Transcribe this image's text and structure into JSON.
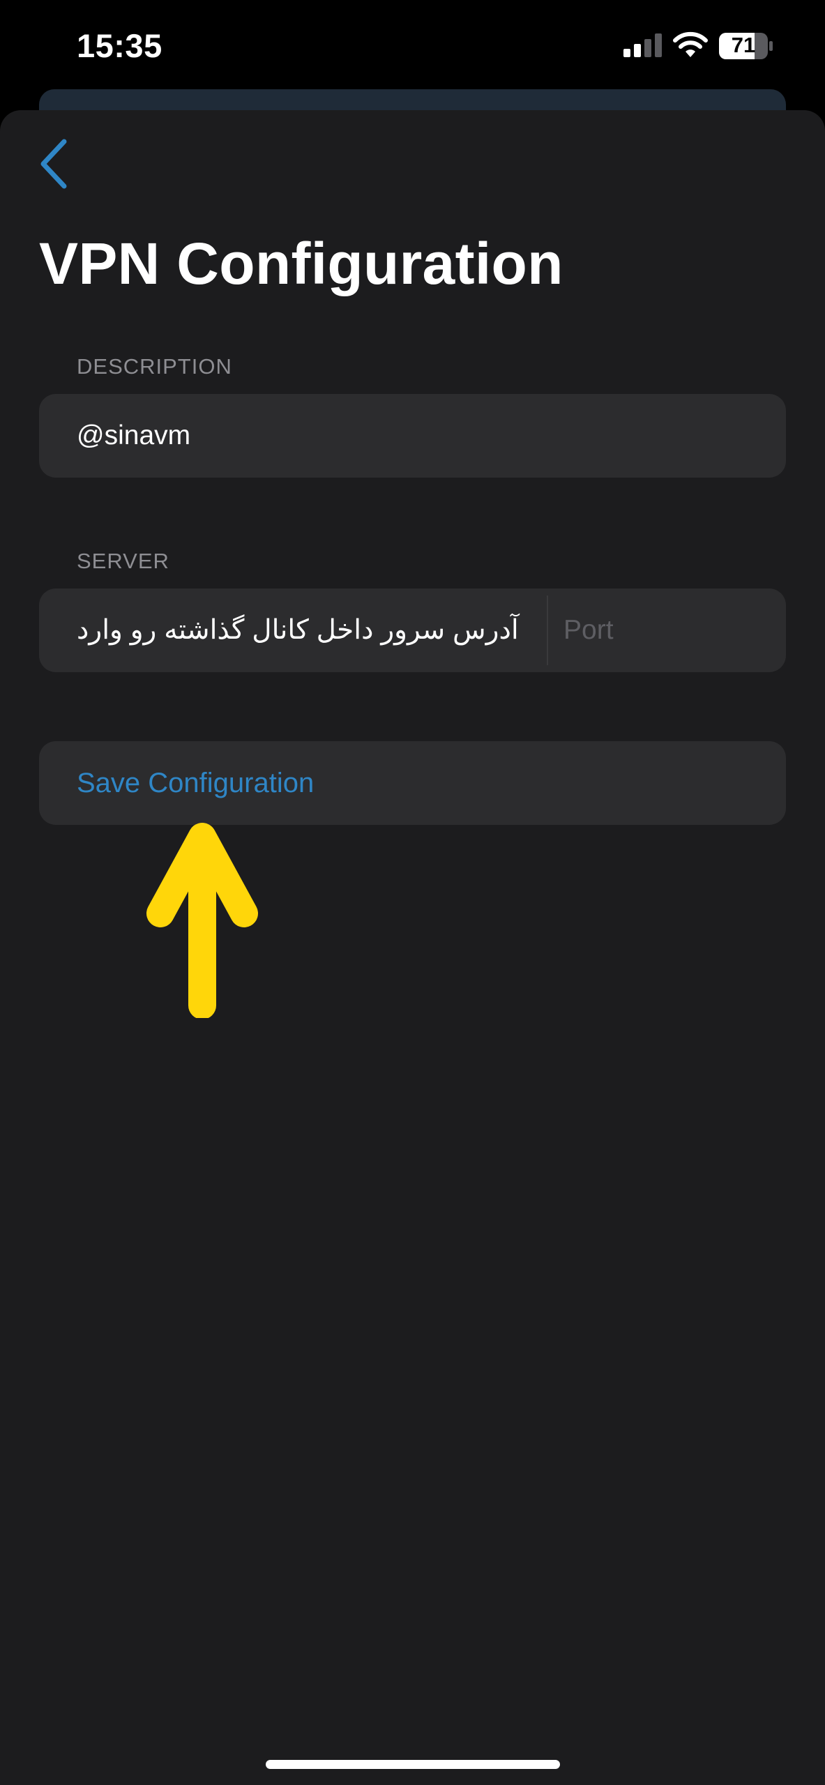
{
  "status_bar": {
    "time": "15:35",
    "battery": "71",
    "icons": [
      "signal-icon",
      "wifi-icon",
      "battery-icon"
    ]
  },
  "nav": {
    "back_icon": "chevron-left-icon"
  },
  "page": {
    "title": "VPN Configuration"
  },
  "description_section": {
    "label": "DESCRIPTION",
    "value": "@sinavm"
  },
  "server_section": {
    "label": "SERVER",
    "address_value": "آدرس سرور داخل کانال گذاشته رو وارد",
    "port_placeholder": "Port"
  },
  "actions": {
    "save_label": "Save Configuration"
  },
  "annotation": {
    "arrow_icon": "arrow-up-icon",
    "arrow_color": "#FFD60A"
  },
  "colors": {
    "accent": "#2F86C6",
    "background": "#1C1C1E",
    "field": "#2C2C2E"
  }
}
